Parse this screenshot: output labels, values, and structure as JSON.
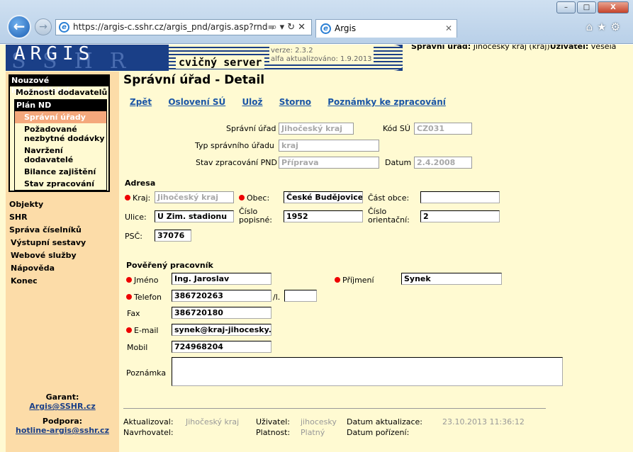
{
  "browser": {
    "url": "https://argis-c.sshr.cz/argis_pnd/argis.asp?rnd=",
    "tab_title": "Argis",
    "minimize": "–",
    "maximize": "□",
    "close": "X"
  },
  "banner": {
    "logo": "ARGIS",
    "logo_shadow": "SSHR",
    "server": "cvičný server",
    "version": "verze: 2.3.2",
    "updated": "alfa aktualizováno: 1.9.2013"
  },
  "header": {
    "office_label": "Správní úřad:",
    "office_value": "Jihočeský kraj (kraj)",
    "user_label": "Uživatel:",
    "user_value": "vesela"
  },
  "sidebar": {
    "group1": "Nouzové hospodářství",
    "item1": "Možnosti dodavatelů",
    "group2": "Plán ND",
    "sub": [
      "Správní úřady",
      "Požadované nezbytné dodávky",
      "Navržení dodavatelé",
      "Bilance zajištění",
      "Stav zpracování"
    ],
    "links": [
      "Objekty",
      "SHR",
      "Správa číselníků",
      "Výstupní sestavy",
      "Webové služby",
      "Nápověda",
      "Konec"
    ],
    "garant_label": "Garant:",
    "garant_email": "Argis@SSHR.cz",
    "support_label": "Podpora:",
    "support_email": "hotline-argis@sshr.cz"
  },
  "main": {
    "title": "Správní úřad - Detail",
    "actions": [
      "Zpět",
      "Oslovení SÚ",
      "Ulož",
      "Storno",
      "Poznámky ke zpracování"
    ]
  },
  "form": {
    "su_label": "Správní úřad",
    "su_value": "Jihočeský kraj",
    "kod_label": "Kód SÚ",
    "kod_value": "CZ031",
    "typ_label": "Typ správního úřadu",
    "typ_value": "kraj",
    "stav_label": "Stav zpracování PND",
    "stav_value": "Příprava",
    "datum_label": "Datum",
    "datum_value": "2.4.2008",
    "address_title": "Adresa",
    "kraj_label": "Kraj:",
    "kraj_value": "Jihočeský kraj",
    "obec_label": "Obec:",
    "obec_value": "České Budějovice",
    "cast_label": "Část obce:",
    "cast_value": "",
    "ulice_label": "Ulice:",
    "ulice_value": "U Zim. stadionu",
    "cp_label1": "Číslo",
    "cp_label2": "popisné:",
    "cp_value": "1952",
    "co_label1": "Číslo",
    "co_label2": "orientační:",
    "co_value": "2",
    "psc_label": "PSČ:",
    "psc_value": "37076",
    "person_title": "Pověřený pracovník",
    "jmeno_label": "Jméno",
    "jmeno_value": "Ing. Jaroslav",
    "prijmeni_label": "Příjmení",
    "prijmeni_value": "Synek",
    "tel_label": "Telefon",
    "tel_value": "386720263",
    "tel_ext_label": "/l.",
    "tel_ext_value": "",
    "fax_label": "Fax",
    "fax_value": "386720180",
    "email_label": "E-mail",
    "email_value": "synek@kraj-jihocesky.cz",
    "mobil_label": "Mobil",
    "mobil_value": "724968204",
    "note_label": "Poznámka"
  },
  "footer": {
    "aktualizoval_label": "Aktualizoval:",
    "aktualizoval_value": "Jihočeský kraj",
    "uzivatel_label": "Uživatel:",
    "uzivatel_value": "jihocesky",
    "datum_akt_label": "Datum aktualizace:",
    "datum_akt_value": "23.10.2013 11:36:12",
    "navrhovatel_label": "Navrhovatel:",
    "platnost_label": "Platnost:",
    "platnost_value": "Platný",
    "datum_por_label": "Datum pořízení:"
  }
}
